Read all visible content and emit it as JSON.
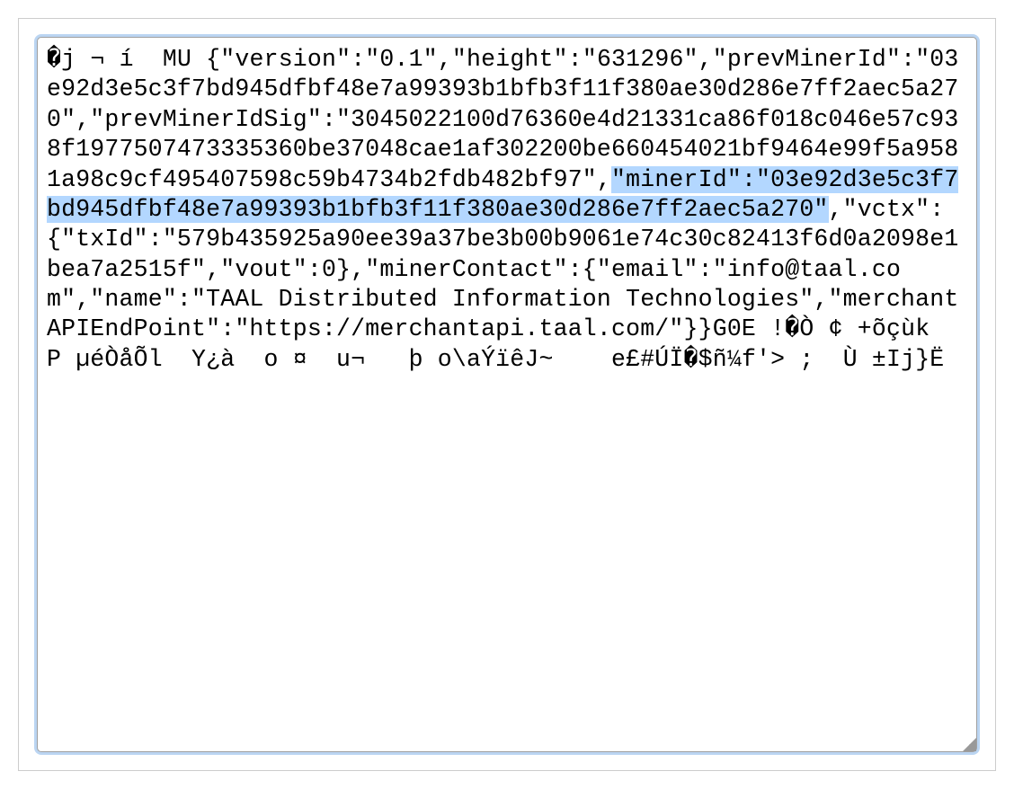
{
  "text": {
    "part1": "�j ¬ í  MU {\"version\":\"0.1\",\"height\":\"631296\",\"prevMinerId\":\"03e92d3e5c3f7bd945dfbf48e7a99393b1bfb3f11f380ae30d286e7ff2aec5a270\",\"prevMinerIdSig\":\"3045022100d76360e4d21331ca86f018c046e57c938f19775074733353​60be37048cae1af302200be660454021bf9464e99f5a9581a98c9cf495407598c59b4734b2fdb482bf97\",",
    "highlighted": "\"minerId\":\"03e92d3e5c3f7bd945dfbf48e7a99393b1bfb3f11f380ae30d286e7ff2aec5a270\"",
    "part2": ",\"vctx\":{\"txId\":\"579b435925a90ee39a37be3b00b9061e74c30c82413f6d0a2098e1bea7a2515f\",\"vout\":0},\"minerContact\":{\"email\":\"info@taal.com\",\"name\":\"TAAL Distributed Information Technologies\",\"merchantAPIEndPoint\":\"https://merchantapi.taal.com/\"}}G0E !�Ò ¢ +õçùk  P µéÒåÕl  Y¿à  o ¤  u¬   þ o\\aÝïêJ~    e£#ÚÏ�$ñ¼f'> ;  Ù ±Ij}Ë"
  }
}
